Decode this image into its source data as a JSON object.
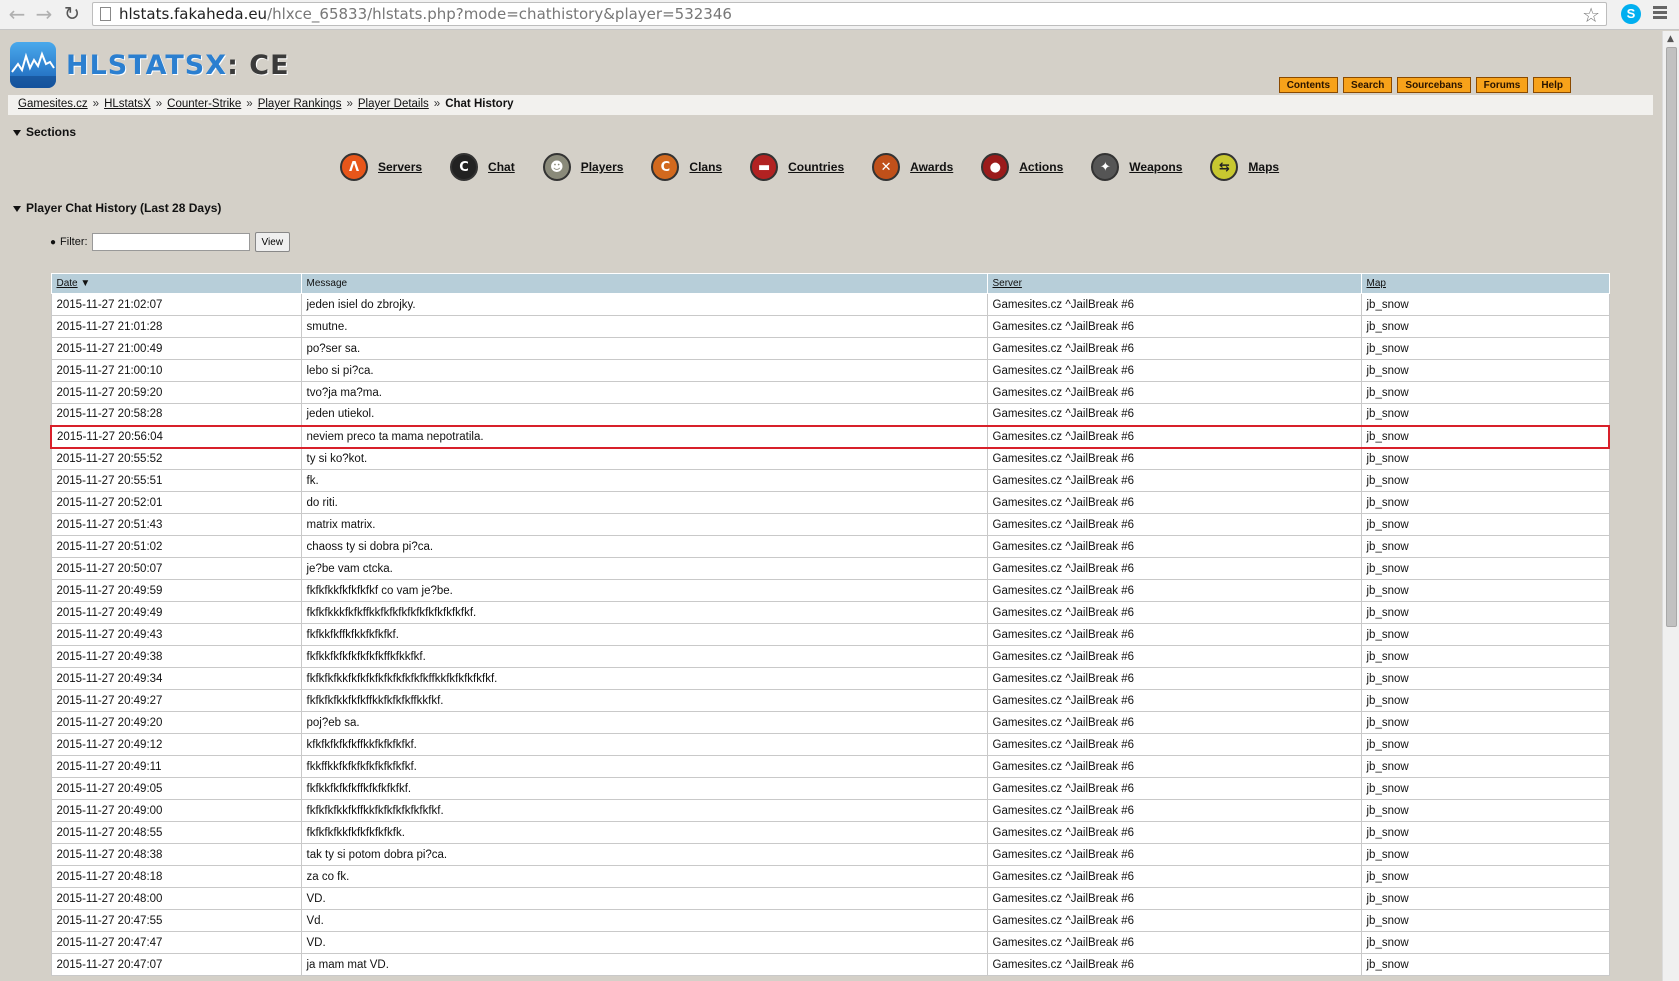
{
  "browser": {
    "url_host": "hlstats.fakaheda.eu",
    "url_path": "/hlxce_65833/hlstats.php?mode=chathistory&player=532346"
  },
  "header": {
    "logo_main": "HLSTATSX",
    "logo_suffix": ": CE",
    "nav": [
      "Contents",
      "Search",
      "Sourcebans",
      "Forums",
      "Help"
    ]
  },
  "breadcrumb": {
    "items": [
      "Gamesites.cz",
      "HLstatsX",
      "Counter-Strike",
      "Player Rankings",
      "Player Details"
    ],
    "current": "Chat History"
  },
  "sections": {
    "title": "Sections",
    "items": [
      {
        "label": "Servers",
        "icon": "servers-icon",
        "color": "#e8561a"
      },
      {
        "label": "Chat",
        "icon": "chat-icon",
        "color": "#222222"
      },
      {
        "label": "Players",
        "icon": "players-icon",
        "color": "#8a8a7a"
      },
      {
        "label": "Clans",
        "icon": "clans-icon",
        "color": "#d2691e"
      },
      {
        "label": "Countries",
        "icon": "countries-icon",
        "color": "#b22222"
      },
      {
        "label": "Awards",
        "icon": "awards-icon",
        "color": "#c0501a"
      },
      {
        "label": "Actions",
        "icon": "actions-icon",
        "color": "#9b1b1b"
      },
      {
        "label": "Weapons",
        "icon": "weapons-icon",
        "color": "#555555"
      },
      {
        "label": "Maps",
        "icon": "maps-icon",
        "color": "#c8c830"
      }
    ]
  },
  "chat_history": {
    "title": "Player Chat History (Last 28 Days)",
    "filter_label": "Filter:",
    "filter_value": "",
    "view_button": "View",
    "columns": {
      "date": "Date",
      "message": "Message",
      "server": "Server",
      "map": "Map"
    },
    "rows": [
      {
        "date": "2015-11-27 21:02:07",
        "message": "jeden isiel do zbrojky.",
        "server": "Gamesites.cz ^JailBreak #6",
        "map": "jb_snow"
      },
      {
        "date": "2015-11-27 21:01:28",
        "message": "smutne.",
        "server": "Gamesites.cz ^JailBreak #6",
        "map": "jb_snow"
      },
      {
        "date": "2015-11-27 21:00:49",
        "message": "po?ser sa.",
        "server": "Gamesites.cz ^JailBreak #6",
        "map": "jb_snow"
      },
      {
        "date": "2015-11-27 21:00:10",
        "message": "lebo si pi?ca.",
        "server": "Gamesites.cz ^JailBreak #6",
        "map": "jb_snow"
      },
      {
        "date": "2015-11-27 20:59:20",
        "message": "tvo?ja ma?ma.",
        "server": "Gamesites.cz ^JailBreak #6",
        "map": "jb_snow"
      },
      {
        "date": "2015-11-27 20:58:28",
        "message": "jeden utiekol.",
        "server": "Gamesites.cz ^JailBreak #6",
        "map": "jb_snow"
      },
      {
        "date": "2015-11-27 20:56:04",
        "message": "neviem preco ta mama nepotratila.",
        "server": "Gamesites.cz ^JailBreak #6",
        "map": "jb_snow",
        "highlighted": true
      },
      {
        "date": "2015-11-27 20:55:52",
        "message": "ty si ko?kot.",
        "server": "Gamesites.cz ^JailBreak #6",
        "map": "jb_snow"
      },
      {
        "date": "2015-11-27 20:55:51",
        "message": "fk.",
        "server": "Gamesites.cz ^JailBreak #6",
        "map": "jb_snow"
      },
      {
        "date": "2015-11-27 20:52:01",
        "message": "do riti.",
        "server": "Gamesites.cz ^JailBreak #6",
        "map": "jb_snow"
      },
      {
        "date": "2015-11-27 20:51:43",
        "message": "matrix matrix.",
        "server": "Gamesites.cz ^JailBreak #6",
        "map": "jb_snow"
      },
      {
        "date": "2015-11-27 20:51:02",
        "message": "chaoss ty si dobra pi?ca.",
        "server": "Gamesites.cz ^JailBreak #6",
        "map": "jb_snow"
      },
      {
        "date": "2015-11-27 20:50:07",
        "message": "je?be vam ctcka.",
        "server": "Gamesites.cz ^JailBreak #6",
        "map": "jb_snow"
      },
      {
        "date": "2015-11-27 20:49:59",
        "message": "fkfkfkkfkfkfkfkf co vam je?be.",
        "server": "Gamesites.cz ^JailBreak #6",
        "map": "jb_snow"
      },
      {
        "date": "2015-11-27 20:49:49",
        "message": "fkfkfkkkfkfkffkkfkfkfkfkfkfkfkfkfkfkf.",
        "server": "Gamesites.cz ^JailBreak #6",
        "map": "jb_snow"
      },
      {
        "date": "2015-11-27 20:49:43",
        "message": "fkfkkfkffkfkkfkfkfkf.",
        "server": "Gamesites.cz ^JailBreak #6",
        "map": "jb_snow"
      },
      {
        "date": "2015-11-27 20:49:38",
        "message": "fkfkkfkfkfkfkfkfkffkfkkfkf.",
        "server": "Gamesites.cz ^JailBreak #6",
        "map": "jb_snow"
      },
      {
        "date": "2015-11-27 20:49:34",
        "message": "fkfkfkfkkfkfkfkfkfkfkfkfkfkffkkfkfkfkfkfkf.",
        "server": "Gamesites.cz ^JailBreak #6",
        "map": "jb_snow"
      },
      {
        "date": "2015-11-27 20:49:27",
        "message": "fkfkfkfkkfkfkffkkfkfkfkffkkfkf.",
        "server": "Gamesites.cz ^JailBreak #6",
        "map": "jb_snow"
      },
      {
        "date": "2015-11-27 20:49:20",
        "message": "poj?eb sa.",
        "server": "Gamesites.cz ^JailBreak #6",
        "map": "jb_snow"
      },
      {
        "date": "2015-11-27 20:49:12",
        "message": "kfkfkfkfkfkffkkfkfkfkfkf.",
        "server": "Gamesites.cz ^JailBreak #6",
        "map": "jb_snow"
      },
      {
        "date": "2015-11-27 20:49:11",
        "message": "fkkffkkfkfkfkfkfkfkfkfkf.",
        "server": "Gamesites.cz ^JailBreak #6",
        "map": "jb_snow"
      },
      {
        "date": "2015-11-27 20:49:05",
        "message": "fkfkkfkfkfkffkfkfkfkfkf.",
        "server": "Gamesites.cz ^JailBreak #6",
        "map": "jb_snow"
      },
      {
        "date": "2015-11-27 20:49:00",
        "message": "fkfkfkfkkfkffkkfkfkfkfkfkfkfkf.",
        "server": "Gamesites.cz ^JailBreak #6",
        "map": "jb_snow"
      },
      {
        "date": "2015-11-27 20:48:55",
        "message": "fkfkfkfkkfkfkfkfkfkfk.",
        "server": "Gamesites.cz ^JailBreak #6",
        "map": "jb_snow"
      },
      {
        "date": "2015-11-27 20:48:38",
        "message": "tak ty si potom dobra pi?ca.",
        "server": "Gamesites.cz ^JailBreak #6",
        "map": "jb_snow"
      },
      {
        "date": "2015-11-27 20:48:18",
        "message": "za co fk.",
        "server": "Gamesites.cz ^JailBreak #6",
        "map": "jb_snow"
      },
      {
        "date": "2015-11-27 20:48:00",
        "message": "VD.",
        "server": "Gamesites.cz ^JailBreak #6",
        "map": "jb_snow"
      },
      {
        "date": "2015-11-27 20:47:55",
        "message": "Vd.",
        "server": "Gamesites.cz ^JailBreak #6",
        "map": "jb_snow"
      },
      {
        "date": "2015-11-27 20:47:47",
        "message": "VD.",
        "server": "Gamesites.cz ^JailBreak #6",
        "map": "jb_snow"
      },
      {
        "date": "2015-11-27 20:47:07",
        "message": "ja mam mat VD.",
        "server": "Gamesites.cz ^JailBreak #6",
        "map": "jb_snow"
      }
    ]
  }
}
